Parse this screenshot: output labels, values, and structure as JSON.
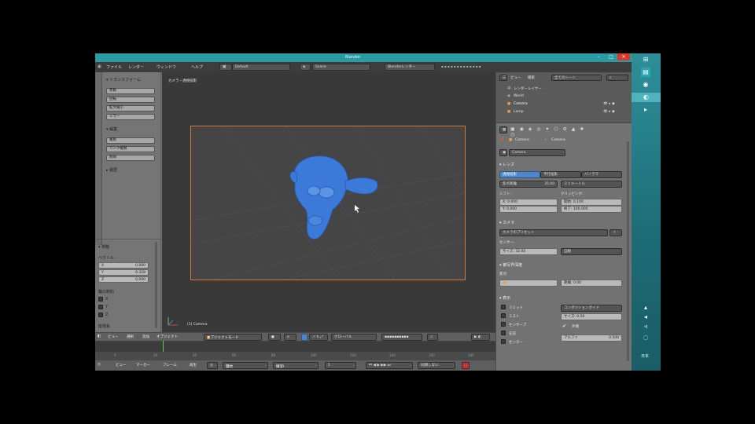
{
  "window": {
    "title": "Blender"
  },
  "menubar": {
    "items": [
      "ファイル",
      "レンダー",
      "ウィンドウ",
      "ヘルプ"
    ],
    "layout_field": "Default",
    "scene_field": "Scene",
    "render_engine": "Blenderレンダー"
  },
  "toolshelf": {
    "tab_title": "▾ トランスフォーム",
    "tools": [
      "移動",
      "回転",
      "拡大縮小",
      "ミラー"
    ],
    "edit_header": "▾ 編集",
    "edit_tools": [
      "複製",
      "リンク複製",
      "削除"
    ],
    "history_header": "▸ 履歴",
    "operator_header": "▾ 移動",
    "vector_label": "ベクトル",
    "vector_values": [
      {
        "axis": "X",
        "value": "0.000"
      },
      {
        "axis": "Y",
        "value": "0.328"
      },
      {
        "axis": "Z",
        "value": "0.000"
      }
    ],
    "constraint_label": "軸の制約",
    "constraint_axes": [
      "X",
      "Y",
      "Z"
    ],
    "orientation_label": "座標系"
  },
  "viewport": {
    "label": "カメラ・透視投影",
    "object_name": "(1) Camera"
  },
  "header3d": {
    "view": "ビュー",
    "select": "選択",
    "add": "追加",
    "object": "オブジェクト",
    "mode": "オブジェクトモード",
    "pivot": "グローバル"
  },
  "timeline_header": {
    "view": "ビュー",
    "marker": "マーカー",
    "frame": "フレーム",
    "playback": "再生",
    "start_label": "開始",
    "start_value": "1",
    "end_label": "終了",
    "end_value": "250",
    "current_frame": "1",
    "sync": "同期しない"
  },
  "outliner": {
    "view_label": "ビュー",
    "search_label": "検索",
    "filter": "全てのシーン",
    "items": [
      {
        "name": "レンダーレイヤー",
        "icon": "render-layer-icon"
      },
      {
        "name": "World",
        "icon": "world-icon"
      },
      {
        "name": "Camera",
        "icon": "camera-icon"
      },
      {
        "name": "Lamp",
        "icon": "lamp-icon"
      }
    ]
  },
  "properties": {
    "breadcrumb_object": "Camera",
    "breadcrumb_data": "Camera",
    "datablock_name": "Camera",
    "lens_header": "▾ レンズ",
    "projection_tabs": [
      "透視投影",
      "平行投影",
      "パノラマ"
    ],
    "focal_label": "焦点距離",
    "focal_value": "35.00",
    "units": "ミリメートル",
    "shift_label": "シフト:",
    "shift_x": "X: 0.000",
    "shift_y": "Y: 0.000",
    "clip_label": "クリッピング:",
    "clip_start": "開始: 0.100",
    "clip_end": "終了: 100.000",
    "camera_header": "▾ カメラ",
    "camera_presets": "カメラのプリセット",
    "sensor_label": "センサー:",
    "sensor_size": "サイズ: 32.00",
    "sensor_fit": "自動",
    "dof_header": "▾ 被写界深度",
    "focus_label": "焦点:",
    "distance_value": "距離: 0.00",
    "display_header": "▾ 表示",
    "display_checks": [
      "リミット",
      "ミスト",
      "センサーブ",
      "名前",
      "センター",
      "中央"
    ],
    "guide": "コンポジションガイド",
    "size_value": "サイズ: 0.50",
    "alpha_label": "アルファ",
    "alpha_value": "0.500",
    "passepartout_label": "外側"
  },
  "taskbar": {
    "time_label": "日本",
    "icons": [
      "windows-icon",
      "folder-icon",
      "blender-icon",
      "app-icon",
      "chevron-icon"
    ]
  },
  "colors": {
    "titlebar": "#2a9aa3",
    "camera_border": "#d57a3a",
    "mesh_blue": "#3b7ad8",
    "selected_tab": "#4f86c9",
    "close_button": "#d9392a"
  }
}
